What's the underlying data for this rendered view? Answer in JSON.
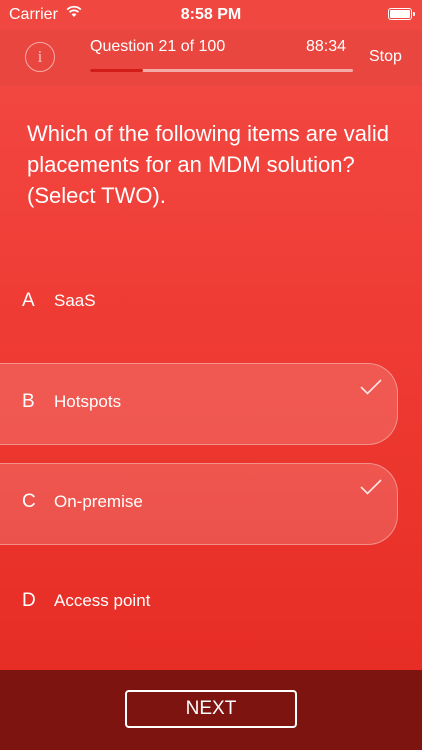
{
  "status_bar": {
    "carrier": "Carrier",
    "time": "8:58 PM",
    "wifi_icon": "wifi-icon",
    "battery_icon": "battery-icon"
  },
  "header": {
    "info_label": "i",
    "question_progress": "Question 21 of 100",
    "progress_fraction": 0.2,
    "timer": "88:34",
    "stop_label": "Stop"
  },
  "question": {
    "text": "Which of the following items are valid placements for an MDM solution? (Select TWO)."
  },
  "options": [
    {
      "letter": "A",
      "text": "SaaS",
      "selected": false
    },
    {
      "letter": "B",
      "text": "Hotspots",
      "selected": true
    },
    {
      "letter": "C",
      "text": "On-premise",
      "selected": true
    },
    {
      "letter": "D",
      "text": "Access point",
      "selected": false
    }
  ],
  "footer": {
    "next_label": "NEXT"
  },
  "colors": {
    "background_top": "#f44a45",
    "background_bottom": "#e52a22",
    "footer": "#7e1410",
    "progress_fill": "#d21c17"
  }
}
